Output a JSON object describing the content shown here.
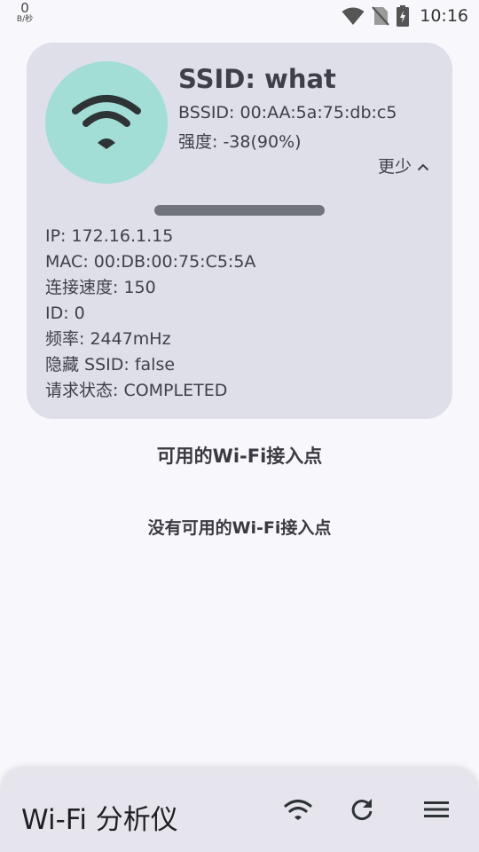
{
  "status_bar": {
    "net_speed_value": "0",
    "net_speed_unit": "B/秒",
    "time": "10:16",
    "icons": [
      "wifi-signal-icon",
      "no-sim-icon",
      "battery-charging-icon"
    ]
  },
  "connection": {
    "ssid": "SSID: what",
    "bssid": "BSSID: 00:AA:5a:75:db:c5",
    "strength": "强度: -38(90%)",
    "toggle_label": "更少",
    "toggle_icon": "chevron-up-icon",
    "icon": "wifi-icon",
    "icon_bg_color": "#a3ded6",
    "details": [
      "IP: 172.16.1.15",
      "MAC: 00:DB:00:75:C5:5A",
      "连接速度: 150",
      "ID: 0",
      "频率: 2447mHz",
      "隐藏 SSID: false",
      "请求状态: COMPLETED"
    ]
  },
  "access_points": {
    "title": "可用的Wi-Fi接入点",
    "empty_message": "没有可用的Wi-Fi接入点"
  },
  "bottom_bar": {
    "title": "Wi-Fi 分析仪",
    "actions": [
      "wifi-icon",
      "refresh-icon",
      "menu-icon"
    ]
  },
  "colors": {
    "card_bg": "#dedfe8",
    "page_bg": "#f8f7fb",
    "bottom_bar_bg": "#e6e5ee"
  }
}
